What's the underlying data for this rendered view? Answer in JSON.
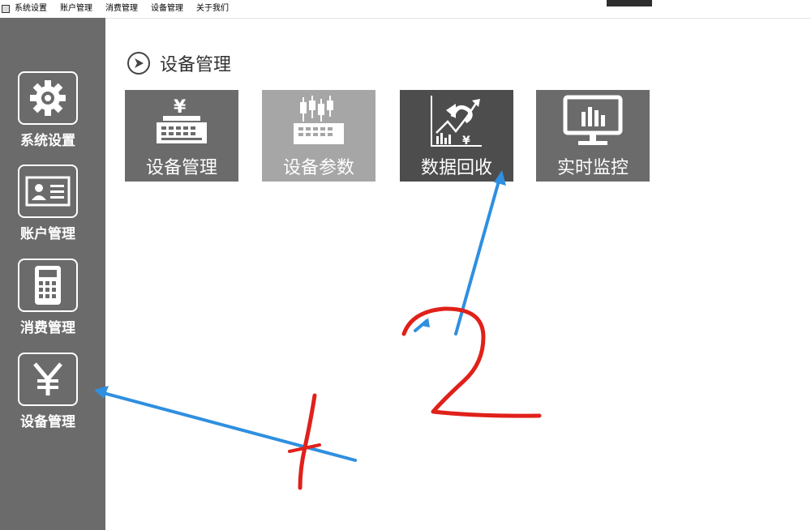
{
  "menubar": {
    "items": [
      "系统设置",
      "账户管理",
      "消费管理",
      "设备管理",
      "关于我们"
    ]
  },
  "sidebar": {
    "items": [
      {
        "label": "系统设置",
        "icon": "gear-icon"
      },
      {
        "label": "账户管理",
        "icon": "id-card-icon"
      },
      {
        "label": "消费管理",
        "icon": "calculator-icon"
      },
      {
        "label": "设备管理",
        "icon": "yen-icon"
      }
    ]
  },
  "main": {
    "title": "设备管理",
    "tiles": [
      {
        "label": "设备管理",
        "icon": "cash-register-icon",
        "color": "#6b6b6b"
      },
      {
        "label": "设备参数",
        "icon": "register-chart-icon",
        "color": "#a6a6a6"
      },
      {
        "label": "数据回收",
        "icon": "data-recovery-icon",
        "color": "#4d4d4d"
      },
      {
        "label": "实时监控",
        "icon": "monitor-icon",
        "color": "#6b6b6b"
      }
    ]
  },
  "annotations": {
    "colors": {
      "arrow": "#2f8fe0",
      "number": "#e0211a"
    }
  }
}
